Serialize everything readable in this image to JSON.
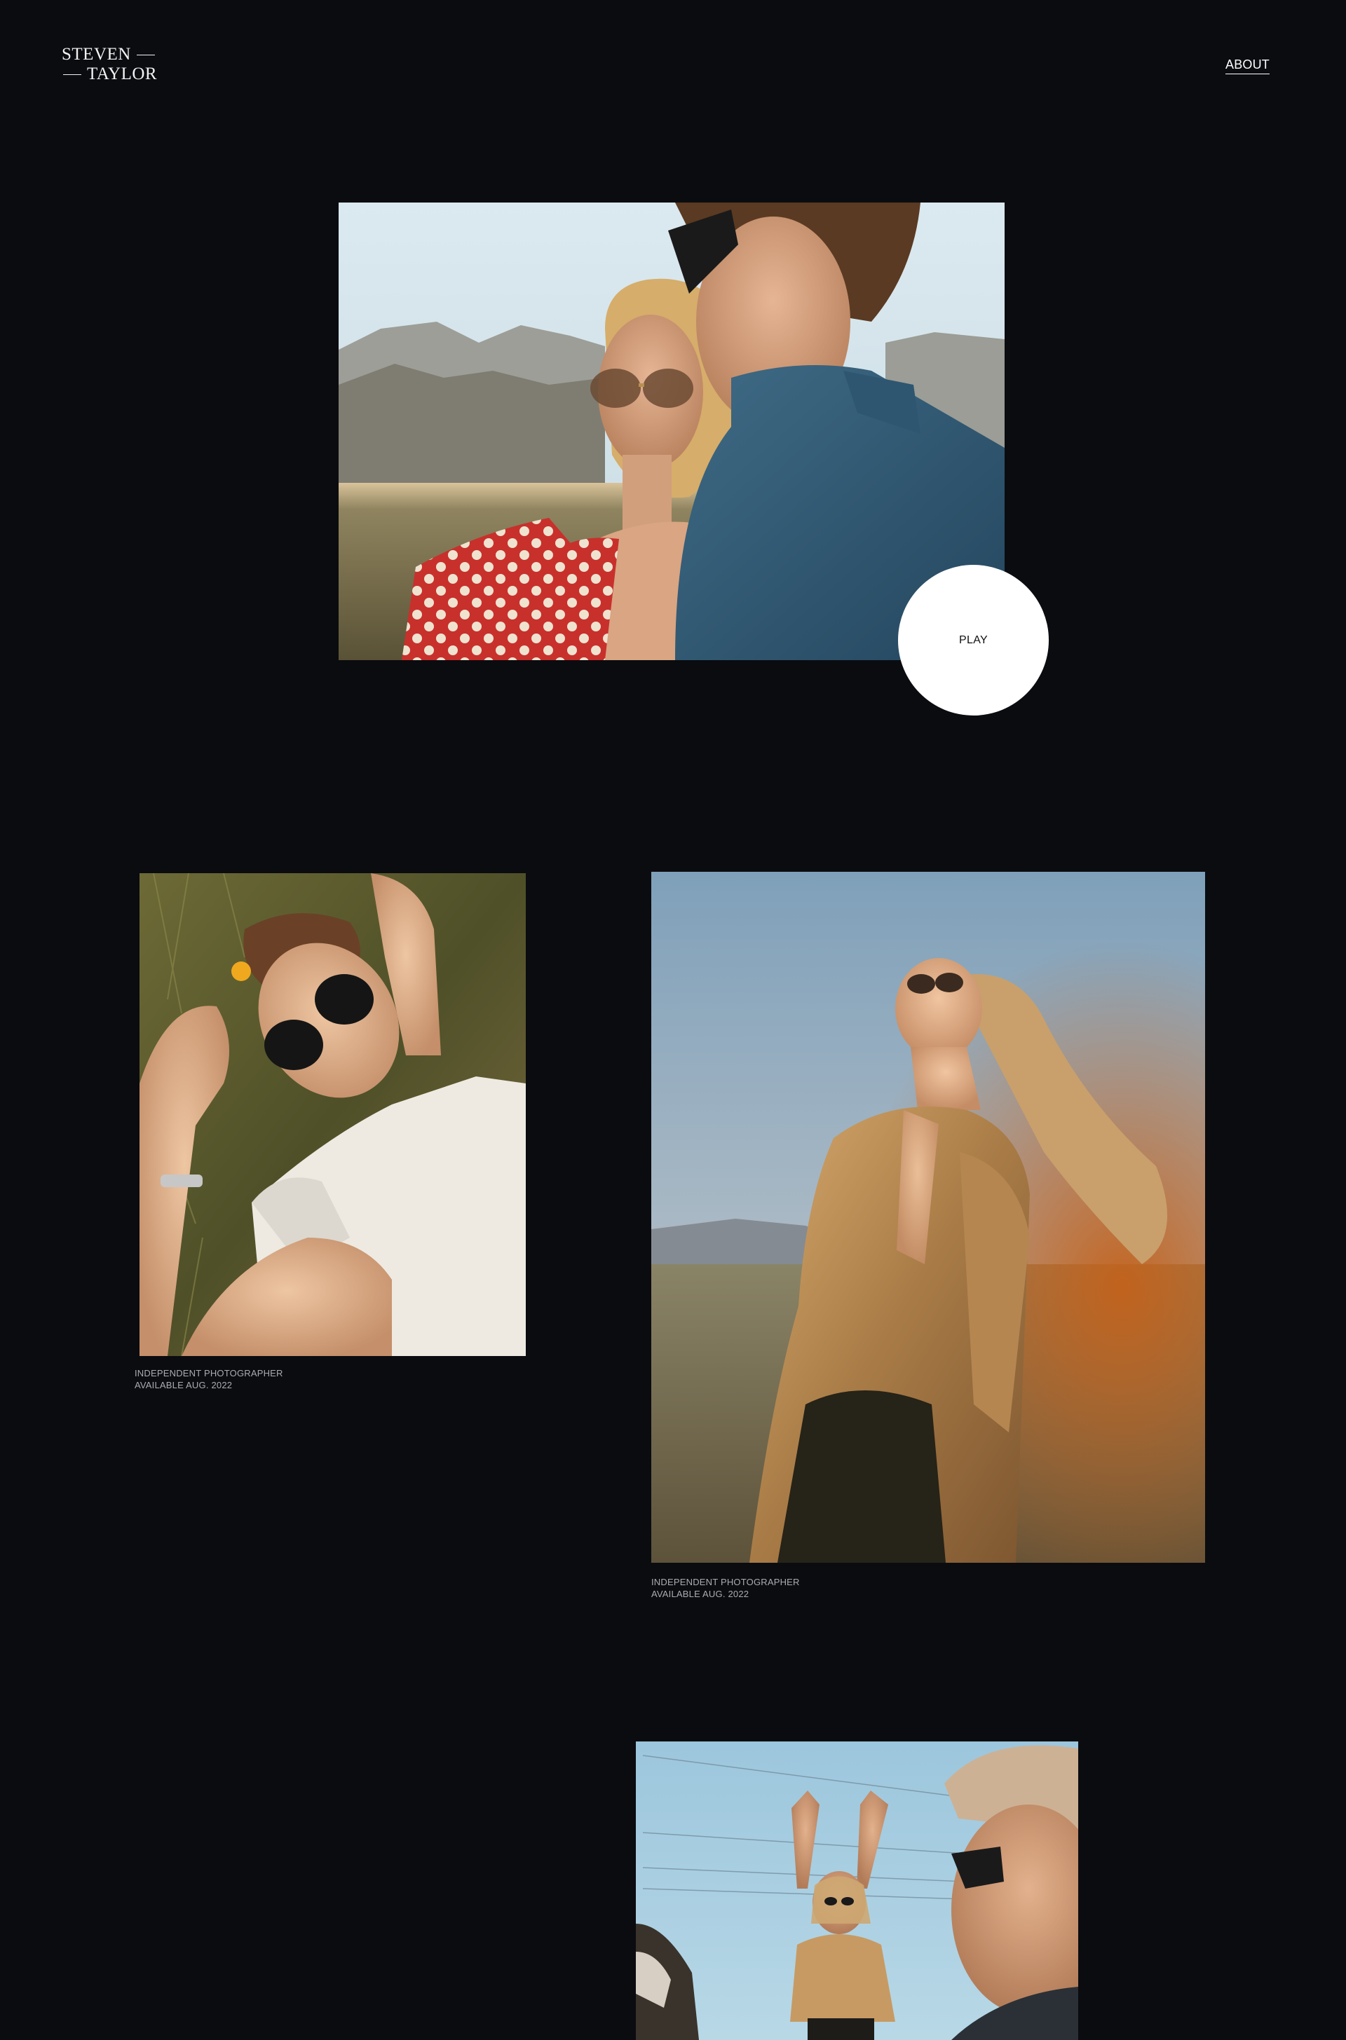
{
  "header": {
    "logo_line1": "STEVEN",
    "logo_line2": "TAYLOR",
    "nav_about": "ABOUT"
  },
  "hero": {
    "play_label": "PLAY",
    "alt": "Couple wearing sunglasses in the desert"
  },
  "gallery": [
    {
      "alt": "Man in sunglasses lying in the grass",
      "caption_line1": "INDEPENDENT PHOTOGRAPHER",
      "caption_line2": "AVAILABLE AUG. 2022"
    },
    {
      "alt": "Woman in gold satin shirt looking at the sky",
      "caption_line1": "INDEPENDENT PHOTOGRAPHER",
      "caption_line2": "AVAILABLE AUG. 2022"
    },
    {
      "alt": "Woman with raised arms and man in beret"
    }
  ],
  "colors": {
    "background": "#0b0c10",
    "text": "#ffffff",
    "caption": "#a9acb2",
    "play_bg": "#ffffff"
  }
}
